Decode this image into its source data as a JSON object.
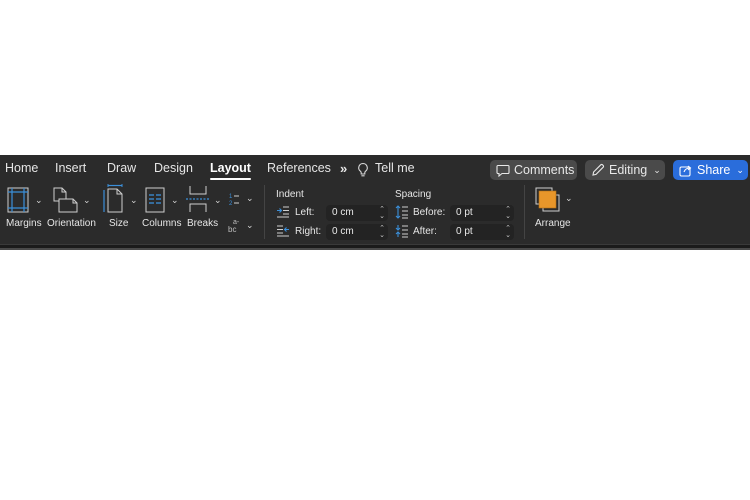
{
  "tabs": [
    {
      "label": "Home",
      "active": false
    },
    {
      "label": "Insert",
      "active": false
    },
    {
      "label": "Draw",
      "active": false
    },
    {
      "label": "Design",
      "active": false
    },
    {
      "label": "Layout",
      "active": true
    },
    {
      "label": "References",
      "active": false
    }
  ],
  "more_tabs_glyph": "»",
  "tell_me": "Tell me",
  "buttons": {
    "comments": "Comments",
    "editing": "Editing",
    "share": "Share"
  },
  "ribbon": {
    "margins": "Margins",
    "orientation": "Orientation",
    "size": "Size",
    "columns": "Columns",
    "breaks": "Breaks",
    "line_numbers_icon": "1- 2-",
    "hyphenation_icon": "a- bc",
    "arrange": "Arrange"
  },
  "indent": {
    "title": "Indent",
    "left_label": "Left:",
    "left_value": "0 cm",
    "right_label": "Right:",
    "right_value": "0 cm"
  },
  "spacing": {
    "title": "Spacing",
    "before_label": "Before:",
    "before_value": "0 pt",
    "after_label": "After:",
    "after_value": "0 pt"
  },
  "colors": {
    "toolbar_bg": "#2b2b2b",
    "accent_blue": "#2a6ddb",
    "icon_blue": "#3b8fd9",
    "arrange_orange": "#e8962a"
  }
}
